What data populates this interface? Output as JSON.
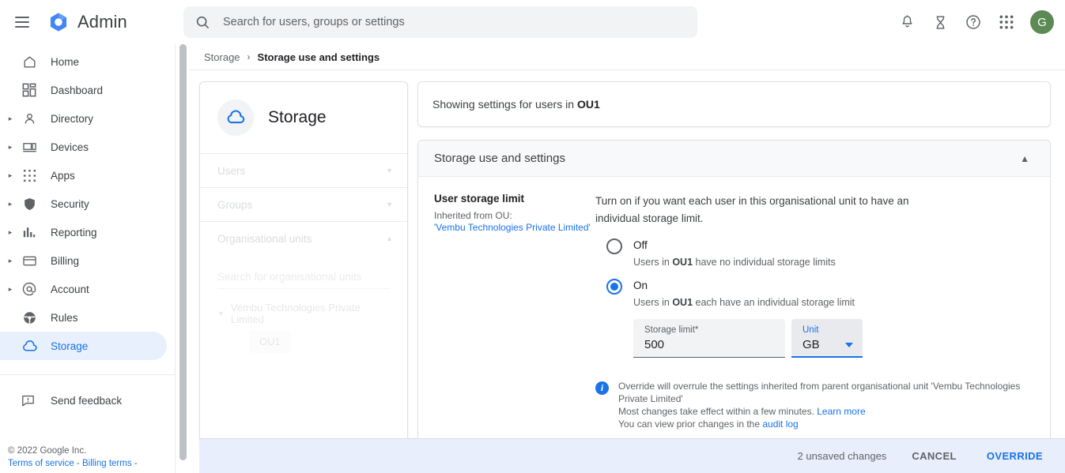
{
  "topbar": {
    "menu_icon": "hamburger-icon",
    "brand": "Admin",
    "search": {
      "placeholder": "Search for users, groups or settings",
      "value": "",
      "icon": "search-icon"
    },
    "actions": [
      {
        "name": "notifications-icon",
        "label": "Notifications"
      },
      {
        "name": "hourglass-icon",
        "label": "Tasks"
      },
      {
        "name": "help-icon",
        "label": "Help"
      },
      {
        "name": "apps-grid-icon",
        "label": "Google apps"
      }
    ],
    "avatar_initial": "G",
    "avatar_color": "#5c8a55"
  },
  "sidebar": {
    "items": [
      {
        "label": "Home",
        "icon": "home-icon",
        "expandable": false,
        "active": false
      },
      {
        "label": "Dashboard",
        "icon": "dashboard-icon",
        "expandable": false,
        "active": false
      },
      {
        "label": "Directory",
        "icon": "person-icon",
        "expandable": true,
        "active": false
      },
      {
        "label": "Devices",
        "icon": "devices-icon",
        "expandable": true,
        "active": false
      },
      {
        "label": "Apps",
        "icon": "apps-dots-icon",
        "expandable": true,
        "active": false
      },
      {
        "label": "Security",
        "icon": "shield-icon",
        "expandable": true,
        "active": false
      },
      {
        "label": "Reporting",
        "icon": "bar-chart-icon",
        "expandable": true,
        "active": false
      },
      {
        "label": "Billing",
        "icon": "credit-card-icon",
        "expandable": true,
        "active": false
      },
      {
        "label": "Account",
        "icon": "at-sign-icon",
        "expandable": true,
        "active": false
      },
      {
        "label": "Rules",
        "icon": "steering-icon",
        "expandable": false,
        "active": false
      },
      {
        "label": "Storage",
        "icon": "cloud-icon",
        "expandable": false,
        "active": true
      }
    ],
    "feedback": {
      "label": "Send feedback",
      "icon": "feedback-icon"
    },
    "footer": {
      "copyright": "© 2022 Google Inc.",
      "terms_link": "Terms of service",
      "separator_1": "-",
      "billing_link": "Billing terms",
      "separator_2": "-"
    },
    "active_color": "#1a73e8",
    "active_bg": "#e8f0fe"
  },
  "breadcrumb": {
    "root": "Storage",
    "separator": "›",
    "current": "Storage use and settings"
  },
  "storage_card": {
    "icon": "cloud-icon",
    "title": "Storage",
    "rows": [
      {
        "label": "Users",
        "chevron": "chevron-down-icon"
      },
      {
        "label": "Groups",
        "chevron": "chevron-down-icon"
      },
      {
        "label": "Organisational units",
        "chevron": "chevron-up-icon"
      }
    ],
    "ou_search_placeholder": "Search for organisational units",
    "ou_tree": {
      "root": "Vembu Technologies Private Limited",
      "child": "OU1"
    }
  },
  "main": {
    "showing_prefix": "Showing settings for users in",
    "showing_ou": "OU1",
    "section": {
      "title": "Storage use and settings",
      "chevron": "chevron-up-icon"
    },
    "setting": {
      "title": "User storage limit",
      "inherited_label": "Inherited from OU:",
      "inherited_ou": "'Vembu Technologies Private Limited'",
      "description": "Turn on if you want each user in this organisational unit to have an individual storage limit.",
      "options": [
        {
          "value": "off",
          "label": "Off",
          "sub_prefix": "Users in",
          "sub_ou": "OU1",
          "sub_suffix": "have no individual storage limits",
          "selected": false
        },
        {
          "value": "on",
          "label": "On",
          "sub_prefix": "Users in",
          "sub_ou": "OU1",
          "sub_suffix": "each have an individual storage limit",
          "selected": true
        }
      ],
      "storage_limit_field": {
        "label": "Storage limit*",
        "value": "500",
        "focused": false
      },
      "unit_field": {
        "label": "Unit",
        "value": "GB",
        "focused": true,
        "caret": "dropdown-caret-icon"
      },
      "info": {
        "icon": "info-icon",
        "line1": "Override will overrule the settings inherited from parent organisational unit 'Vembu Technologies Private Limited'",
        "line2_text": "Most changes take effect within a few minutes.",
        "line2_link": "Learn more",
        "line3_text": "You can view prior changes in the",
        "line3_link": "audit log"
      }
    }
  },
  "action_bar": {
    "unsaved": "2 unsaved changes",
    "cancel": "CANCEL",
    "override": "OVERRIDE",
    "background": "#e8eefb",
    "primary_color": "#1a73e8"
  }
}
